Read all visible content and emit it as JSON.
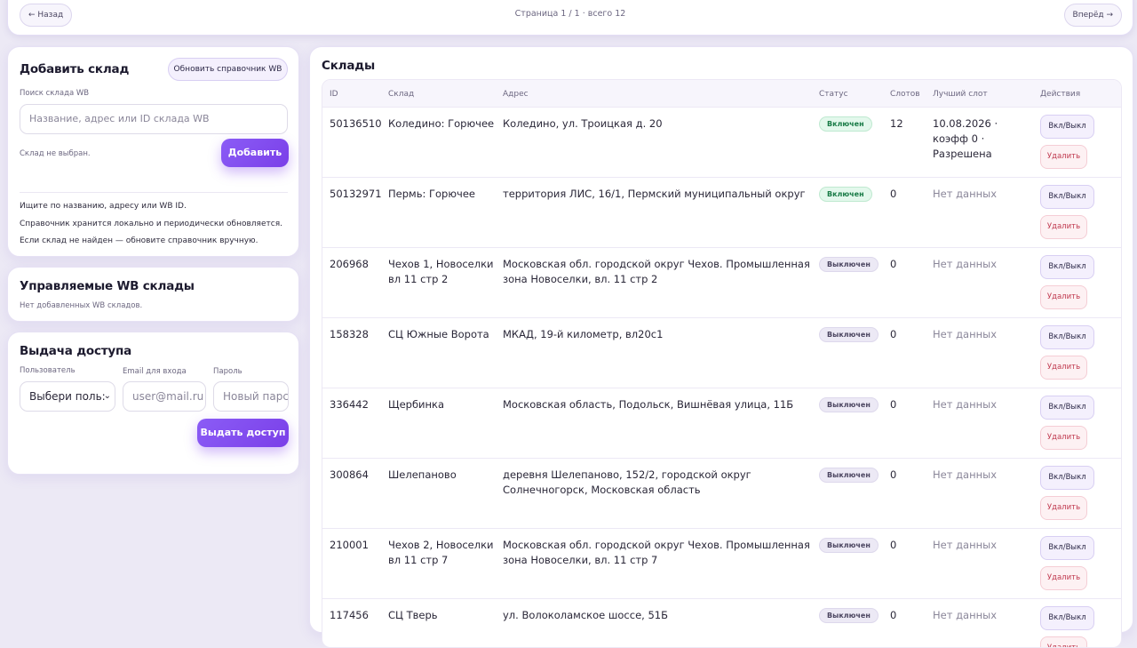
{
  "pager": {
    "back_label": "← Назад",
    "info": "Страница 1 / 1 · всего 12",
    "forward_label": "Вперёд →"
  },
  "add_warehouse": {
    "title": "Добавить склад",
    "refresh_label": "Обновить справочник WB",
    "search_label": "Поиск склада WB",
    "search_placeholder": "Название, адрес или ID склада WB",
    "selection_status": "Склад не выбран.",
    "add_label": "Добавить",
    "help": [
      "Ищите по названию, адресу или WB ID.",
      "Справочник хранится локально и периодически обновляется.",
      "Если склад не найден — обновите справочник вручную."
    ]
  },
  "managed": {
    "title": "Управляемые WB склады",
    "empty_text": "Нет добавленных WB складов."
  },
  "access": {
    "title": "Выдача доступа",
    "user_label": "Пользователь",
    "email_label": "Email для входа",
    "password_label": "Пароль",
    "user_select_value": "Выбери поль:",
    "email_placeholder": "user@mail.ru",
    "password_placeholder": "Новый парс",
    "grant_label": "Выдать доступ"
  },
  "warehouses": {
    "title": "Склады",
    "columns": [
      "ID",
      "Склад",
      "Адрес",
      "Статус",
      "Слотов",
      "Лучший слот",
      "Действия"
    ],
    "toggle_label": "Вкл/Выкл",
    "delete_label": "Удалить",
    "rows": [
      {
        "id": "50136510",
        "name": "Коледино: Горючее",
        "address": "Коледино, ул. Троицкая д. 20",
        "status": "Включен",
        "status_kind": "on",
        "slots": "12",
        "best_slot": "10.08.2026 · коэфф 0 · Разрешена"
      },
      {
        "id": "50132971",
        "name": "Пермь: Горючее",
        "address": "территория ЛИС, 16/1, Пермский муниципальный округ",
        "status": "Включен",
        "status_kind": "on",
        "slots": "0",
        "best_slot": "Нет данных"
      },
      {
        "id": "206968",
        "name": "Чехов 1, Новоселки вл 11 стр 2",
        "address": "Московская обл. городской округ Чехов. Промышленная зона Новоселки, вл. 11 стр 2",
        "status": "Выключен",
        "status_kind": "off",
        "slots": "0",
        "best_slot": "Нет данных"
      },
      {
        "id": "158328",
        "name": "СЦ Южные Ворота",
        "address": "МКАД, 19-й километр, вл20с1",
        "status": "Выключен",
        "status_kind": "off",
        "slots": "0",
        "best_slot": "Нет данных"
      },
      {
        "id": "336442",
        "name": "Щербинка",
        "address": "Московская область, Подольск, Вишнёвая улица, 11Б",
        "status": "Выключен",
        "status_kind": "off",
        "slots": "0",
        "best_slot": "Нет данных"
      },
      {
        "id": "300864",
        "name": "Шелепаново",
        "address": "деревня Шелепаново, 152/2, городской округ Солнечногорск, Московская область",
        "status": "Выключен",
        "status_kind": "off",
        "slots": "0",
        "best_slot": "Нет данных"
      },
      {
        "id": "210001",
        "name": "Чехов 2, Новоселки вл 11 стр 7",
        "address": "Московская обл. городской округ Чехов. Промышленная зона Новоселки, вл. 11 стр 7",
        "status": "Выключен",
        "status_kind": "off",
        "slots": "0",
        "best_slot": "Нет данных"
      },
      {
        "id": "117456",
        "name": "СЦ Тверь",
        "address": "ул. Волоколамское шоссе, 51Б",
        "status": "Выключен",
        "status_kind": "off",
        "slots": "0",
        "best_slot": "Нет данных"
      }
    ]
  },
  "colors": {
    "accent": "#7c3aed",
    "status_on": "#177a45",
    "delete": "#c0394f"
  }
}
